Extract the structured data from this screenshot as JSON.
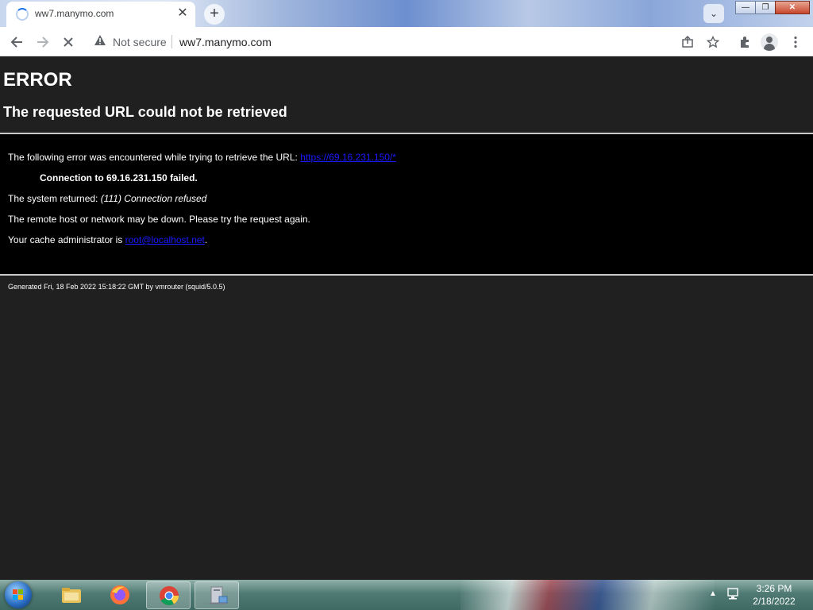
{
  "browser": {
    "tab_title": "ww7.manymo.com",
    "tab_close": "✕",
    "new_tab": "+",
    "tab_search": "⌄",
    "window_buttons": {
      "minimize": "—",
      "restore": "❐",
      "close": "✕"
    },
    "omnibox": {
      "security_label": "Not secure",
      "url": "ww7.manymo.com"
    },
    "icons": [
      "back-icon",
      "forward-icon",
      "stop-icon",
      "warning-icon",
      "share-icon",
      "star-icon",
      "extensions-icon",
      "profile-icon",
      "menu-icon"
    ]
  },
  "page": {
    "heading": "ERROR",
    "subheading": "The requested URL could not be retrieved",
    "intro_text": "The following error was encountered while trying to retrieve the URL: ",
    "intro_link": "https://69.16.231.150/*",
    "connection_failed": "Connection to 69.16.231.150 failed.",
    "system_returned_label": "The system returned: ",
    "system_returned_value": "(111) Connection refused",
    "remote_host_text": "The remote host or network may be down. Please try the request again.",
    "cache_admin_text": "Your cache administrator is ",
    "cache_admin_link": "root@localhost.net",
    "cache_admin_suffix": ".",
    "footer": "Generated Fri, 18 Feb 2022 15:18:22 GMT by vmrouter (squid/5.0.5)"
  },
  "taskbar": {
    "apps": [
      "windows-explorer",
      "firefox",
      "chrome",
      "network-computer"
    ],
    "clock_time": "3:26 PM",
    "clock_date": "2/18/2022"
  }
}
